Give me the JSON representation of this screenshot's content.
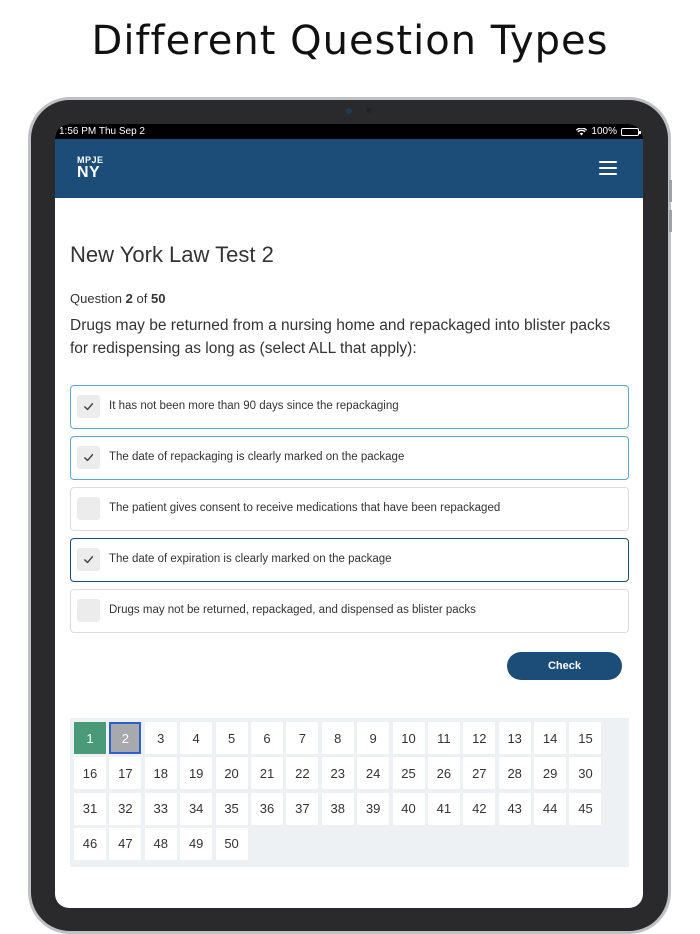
{
  "headline": "Different Question Types",
  "status_bar": {
    "time_date": "1:56 PM  Thu Sep 2",
    "battery": "100%",
    "battery_level": 1.0
  },
  "navbar": {
    "logo_top": "MPJE",
    "logo_bottom": "NY",
    "menu_icon": "hamburger-menu-icon"
  },
  "test": {
    "title": "New York Law Test 2",
    "question_label": "Question",
    "question_number": "2",
    "of_label": "of",
    "question_total": "50",
    "question_text": "Drugs may be returned from a nursing home and repackaged into blister packs for redispensing as long as (select ALL that apply):"
  },
  "options": [
    {
      "label": "It has not been more than 90 days since the repackaging",
      "checked": true,
      "state": "sel-light"
    },
    {
      "label": "The date of repackaging is clearly marked on the package",
      "checked": true,
      "state": "sel-light"
    },
    {
      "label": "The patient gives consent to receive medications that have been repackaged",
      "checked": false,
      "state": ""
    },
    {
      "label": "The date of expiration is clearly marked on the package",
      "checked": true,
      "state": "sel-dark"
    },
    {
      "label": "Drugs may not be returned, repackaged, and dispensed as blister packs",
      "checked": false,
      "state": ""
    }
  ],
  "check_button": "Check",
  "question_grid": {
    "answered": [
      1
    ],
    "current": 2,
    "numbers": [
      "1",
      "2",
      "3",
      "4",
      "5",
      "6",
      "7",
      "8",
      "9",
      "10",
      "11",
      "12",
      "13",
      "14",
      "15",
      "16",
      "17",
      "18",
      "19",
      "20",
      "21",
      "22",
      "23",
      "24",
      "25",
      "26",
      "27",
      "28",
      "29",
      "30",
      "31",
      "32",
      "33",
      "34",
      "35",
      "36",
      "37",
      "38",
      "39",
      "40",
      "41",
      "42",
      "43",
      "44",
      "45",
      "46",
      "47",
      "48",
      "49",
      "50"
    ]
  },
  "colors": {
    "nav": "#1c4d78",
    "answered": "#4b9a77",
    "current": "#a7a9ad",
    "selected_border_light": "#5fa6d6",
    "selected_border_dark": "#1c4d78"
  }
}
